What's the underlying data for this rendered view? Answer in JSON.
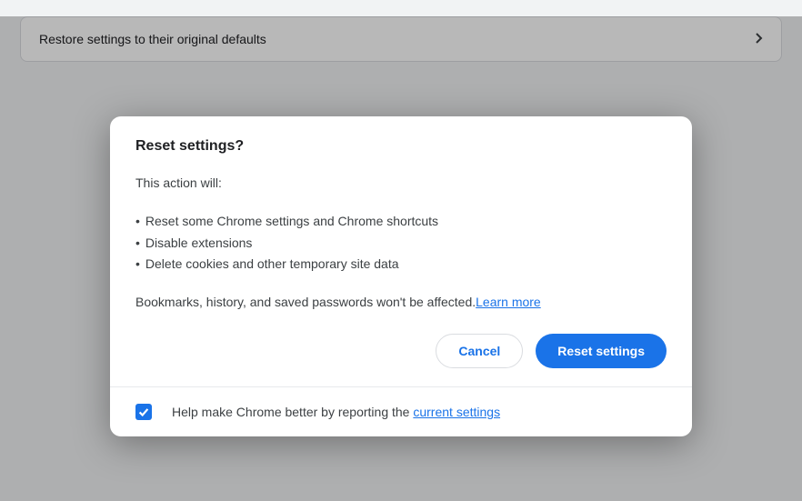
{
  "background": {
    "row_label": "Restore settings to their original defaults"
  },
  "dialog": {
    "title": "Reset settings?",
    "intro": "This action will:",
    "bullets": [
      "Reset some Chrome settings and Chrome shortcuts",
      "Disable extensions",
      "Delete cookies and other temporary site data"
    ],
    "footnote_text": "Bookmarks, history, and saved passwords won't be affected.",
    "learn_more": "Learn more",
    "cancel_label": "Cancel",
    "confirm_label": "Reset settings",
    "footer_text_prefix": "Help make Chrome better by reporting the ",
    "footer_link": "current settings",
    "checkbox_checked": true
  }
}
